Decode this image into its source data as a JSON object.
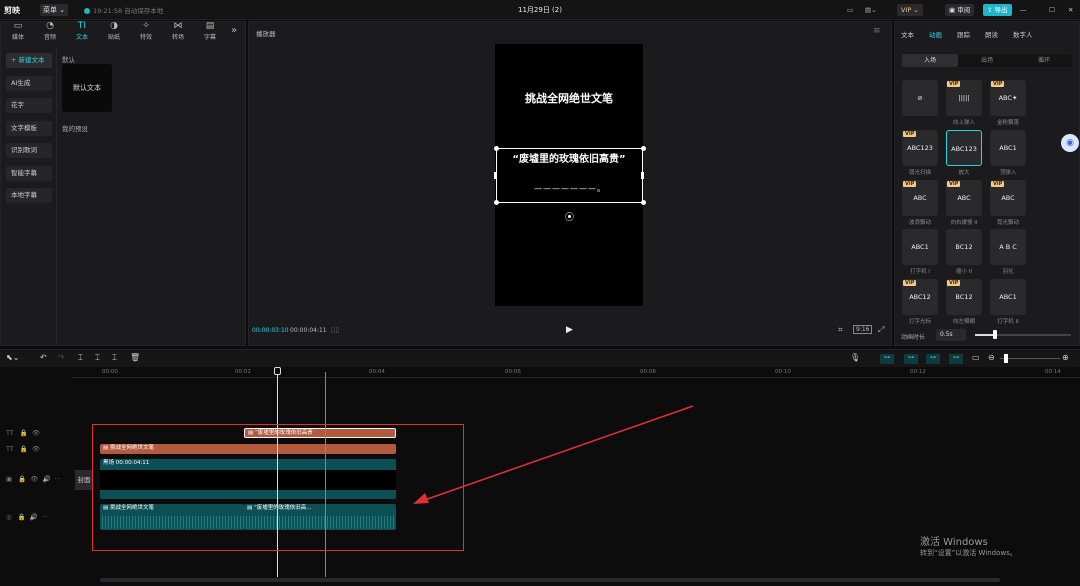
{
  "app": {
    "logo": "剪映",
    "menu": "菜单",
    "saved": "19:21:58 自动保存本地",
    "title": "11月29日 (2)",
    "vip": "VIP",
    "review": "审阅",
    "export": "导出"
  },
  "left_tabs": [
    {
      "label": "媒体",
      "icon": "▭"
    },
    {
      "label": "音频",
      "icon": "◔"
    },
    {
      "label": "文本",
      "icon": "TI"
    },
    {
      "label": "贴纸",
      "icon": "◑"
    },
    {
      "label": "特效",
      "icon": "✧"
    },
    {
      "label": "转场",
      "icon": "⋈"
    },
    {
      "label": "字幕",
      "icon": "▤"
    }
  ],
  "sidebar": [
    "+ 新建文本",
    "AI生成",
    "花字",
    "文字模板",
    "识别歌词",
    "智能字幕",
    "本地字幕"
  ],
  "text_panel": {
    "default_header": "默认",
    "card_label": "默认文本",
    "my_presets": "我的预设"
  },
  "player": {
    "title": "播放器",
    "video_title": "挑战全网绝世文笔",
    "video_subtitle": "“废墟里的玫瑰依旧高贵”",
    "video_dashes": "———————。",
    "time_current": "00:00:03:10",
    "time_total": "00:00:04:11"
  },
  "right_tabs": [
    "文本",
    "动画",
    "跟踪",
    "朗读",
    "数字人"
  ],
  "anim_segments": [
    "入场",
    "出场",
    "循环"
  ],
  "animations": [
    {
      "text": "⊘",
      "label": "",
      "vip": false,
      "selected": false
    },
    {
      "text": "|||||",
      "label": "向上弹入",
      "vip": true,
      "selected": false
    },
    {
      "text": "ABC✦",
      "label": "金粉飘落",
      "vip": true,
      "selected": false
    },
    {
      "text": "ABC123",
      "label": "弱光扫描",
      "vip": true,
      "selected": false
    },
    {
      "text": "ABC123",
      "label": "放大",
      "vip": false,
      "selected": true
    },
    {
      "text": "ABC1",
      "label": "顶弹入",
      "vip": false,
      "selected": false
    },
    {
      "text": "ABC",
      "label": "波浪飘动",
      "vip": true,
      "selected": false
    },
    {
      "text": "ABC",
      "label": "向右缓慢 II",
      "vip": true,
      "selected": false
    },
    {
      "text": "ABC",
      "label": "霓光飘动",
      "vip": true,
      "selected": false
    },
    {
      "text": "ABC1",
      "label": "打字机 I",
      "vip": false,
      "selected": false
    },
    {
      "text": "BC12",
      "label": "缩小 II",
      "vip": false,
      "selected": false
    },
    {
      "text": "A B C",
      "label": "羽化",
      "vip": false,
      "selected": false
    },
    {
      "text": "ABC12",
      "label": "打字光标",
      "vip": true,
      "selected": false
    },
    {
      "text": "BC12",
      "label": "向左模糊",
      "vip": true,
      "selected": false
    },
    {
      "text": "ABC1",
      "label": "打字机 II",
      "vip": false,
      "selected": false
    }
  ],
  "anim_duration": {
    "label": "动画时长",
    "value": "0.5s"
  },
  "ruler": [
    "00:00",
    "00:02",
    "00:04",
    "00:06",
    "00:08",
    "00:10",
    "00:12",
    "00:14"
  ],
  "tracks": {
    "cover": "封面"
  },
  "clips": {
    "text2": "“废墟里的玫瑰依旧高贵",
    "text1": "挑战全网绝世文笔",
    "video": "黑场  00:00:04:11",
    "audio1": "挑战全网绝世文笔",
    "audio2": "“废墟里的玫瑰依旧高..."
  },
  "watermark": {
    "line1": "激活 Windows",
    "line2": "转到“设置”以激活 Windows。"
  }
}
